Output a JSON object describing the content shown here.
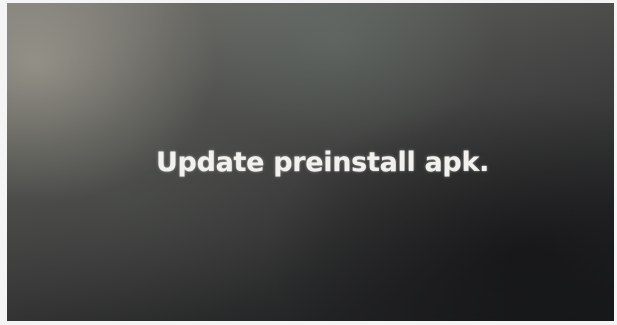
{
  "screen": {
    "message": "Update preinstall apk."
  }
}
